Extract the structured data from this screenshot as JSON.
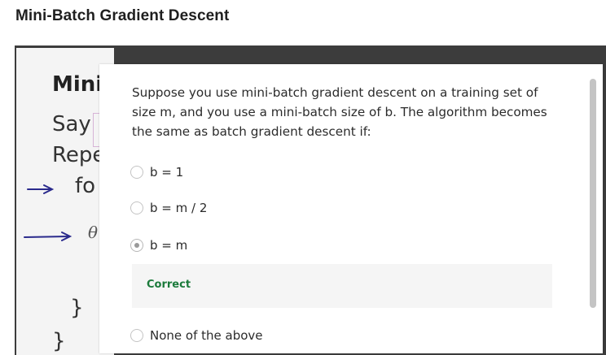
{
  "page": {
    "title": "Mini-Batch Gradient Descent"
  },
  "slide": {
    "heading": "Mini",
    "line_say": "Say",
    "line_repeat": "Repe",
    "line_for": "fo",
    "line_theta": "θ",
    "brace_inner": "}",
    "brace_outer": "}",
    "ink_color": "#2a2a8c"
  },
  "quiz": {
    "question": "Suppose you use mini-batch gradient descent on a training set of size m, and you use a mini-batch size of b. The algorithm becomes the same as batch gradient descent if:",
    "options": [
      {
        "label": "b = 1",
        "selected": false
      },
      {
        "label": "b = m / 2",
        "selected": false
      },
      {
        "label": "b = m",
        "selected": true
      },
      {
        "label": "None of the above",
        "selected": false
      }
    ],
    "feedback": {
      "text": "Correct",
      "color": "#1b7a3b"
    }
  },
  "colors": {
    "video_background": "#3c3c3c",
    "dialog_background": "#ffffff",
    "feedback_background": "#f5f5f5"
  }
}
